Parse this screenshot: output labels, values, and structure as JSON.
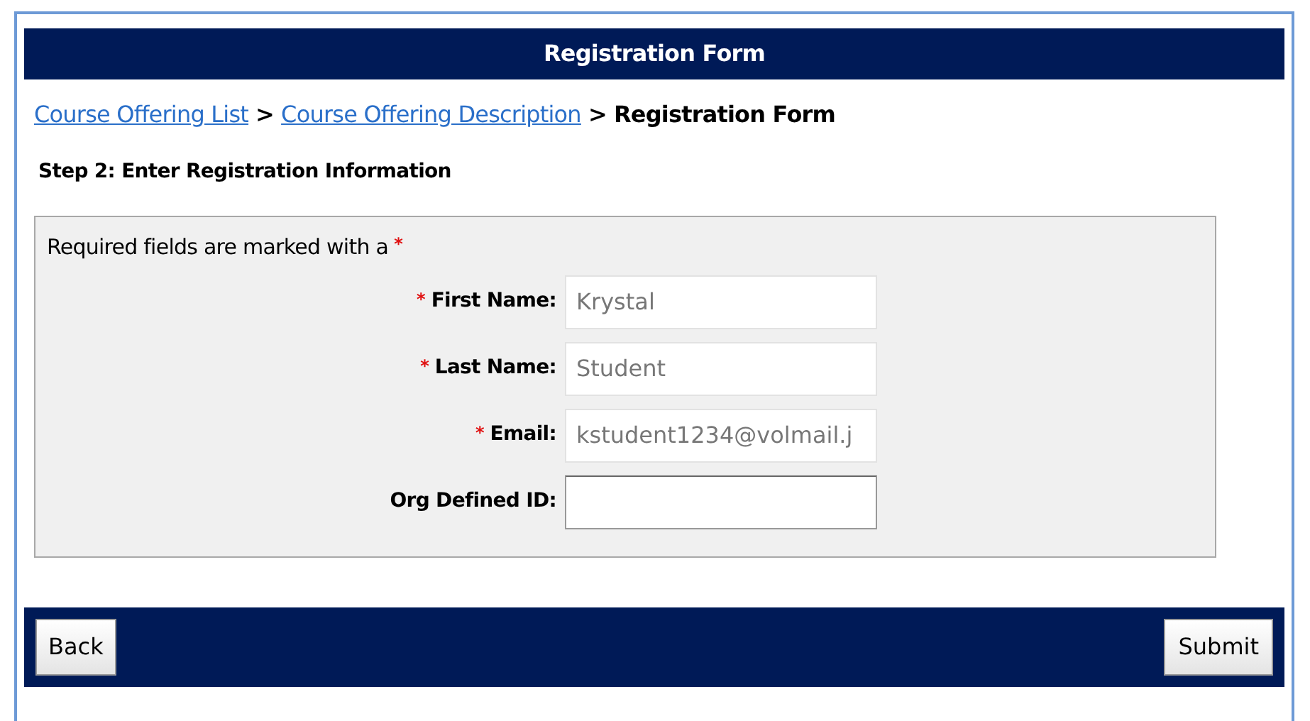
{
  "header": {
    "title": "Registration Form"
  },
  "breadcrumb": {
    "links": [
      "Course Offering List",
      "Course Offering Description"
    ],
    "separators": [
      ">",
      ">"
    ],
    "current": "Registration Form"
  },
  "step_title": "Step 2: Enter Registration Information",
  "required_note": {
    "text": "Required fields are marked with a",
    "marker": "*"
  },
  "fields": [
    {
      "label": "First Name:",
      "required": true,
      "value": "Krystal",
      "disabled": true
    },
    {
      "label": "Last Name:",
      "required": true,
      "value": "Student",
      "disabled": true
    },
    {
      "label": "Email:",
      "required": true,
      "value": "kstudent1234@volmail.j",
      "disabled": true
    },
    {
      "label": "Org Defined ID:",
      "required": false,
      "disabled": false
    }
  ],
  "buttons": {
    "back": "Back",
    "submit": "Submit"
  }
}
